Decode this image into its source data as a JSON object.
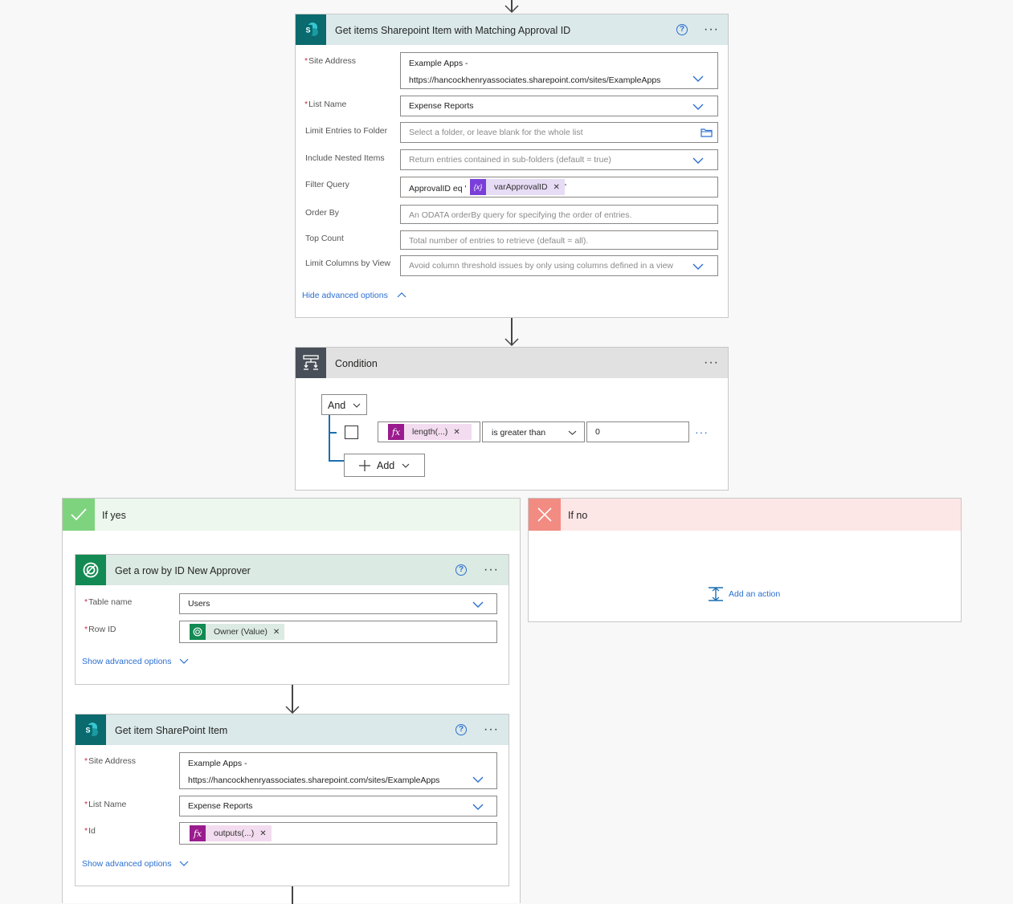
{
  "sp_card": {
    "title": "Get items Sharepoint Item with Matching Approval ID",
    "fields": {
      "site_address": {
        "label": "Site Address",
        "line1": "Example Apps -",
        "line2": "https://hancockhenryassociates.sharepoint.com/sites/ExampleApps"
      },
      "list_name": {
        "label": "List Name",
        "value": "Expense Reports"
      },
      "limit_folder": {
        "label": "Limit Entries to Folder",
        "placeholder": "Select a folder, or leave blank for the whole list"
      },
      "nested": {
        "label": "Include Nested Items",
        "placeholder": "Return entries contained in sub-folders (default = true)"
      },
      "filter": {
        "label": "Filter Query",
        "prefix": "ApprovalID eq '",
        "token": "varApprovalID",
        "token_icon": "{x}",
        "suffix": "'"
      },
      "order_by": {
        "label": "Order By",
        "placeholder": "An ODATA orderBy query for specifying the order of entries."
      },
      "top_count": {
        "label": "Top Count",
        "placeholder": "Total number of entries to retrieve (default = all)."
      },
      "limit_columns": {
        "label": "Limit Columns by View",
        "placeholder": "Avoid column threshold issues by only using columns defined in a view"
      }
    },
    "advanced_link": "Hide advanced options"
  },
  "condition": {
    "title": "Condition",
    "group_operator": "And",
    "row": {
      "token": "length(...)",
      "token_icon": "fx",
      "operator": "is greater than",
      "value": "0"
    },
    "add_label": "Add"
  },
  "if_yes": {
    "title": "If yes",
    "get_row": {
      "title": "Get a row by ID New Approver",
      "table_label": "Table name",
      "table_value": "Users",
      "rowid_label": "Row ID",
      "rowid_token": "Owner (Value)",
      "advanced_link": "Show advanced options"
    },
    "get_item": {
      "title": "Get item SharePoint Item",
      "site_label": "Site Address",
      "site_line1": "Example Apps -",
      "site_line2": "https://hancockhenryassociates.sharepoint.com/sites/ExampleApps",
      "list_label": "List Name",
      "list_value": "Expense Reports",
      "id_label": "Id",
      "id_token": "outputs(...)",
      "id_token_icon": "fx",
      "advanced_link": "Show advanced options"
    }
  },
  "if_no": {
    "title": "If no",
    "add_action": "Add an action"
  },
  "colors": {
    "sharepoint": "#0b6a6d",
    "dataverse": "#138a53",
    "expression": "#9a1b8e",
    "variable": "#7b3fd9",
    "yes": "#7ed37e",
    "no": "#f28b82",
    "link": "#2b6fd0"
  }
}
